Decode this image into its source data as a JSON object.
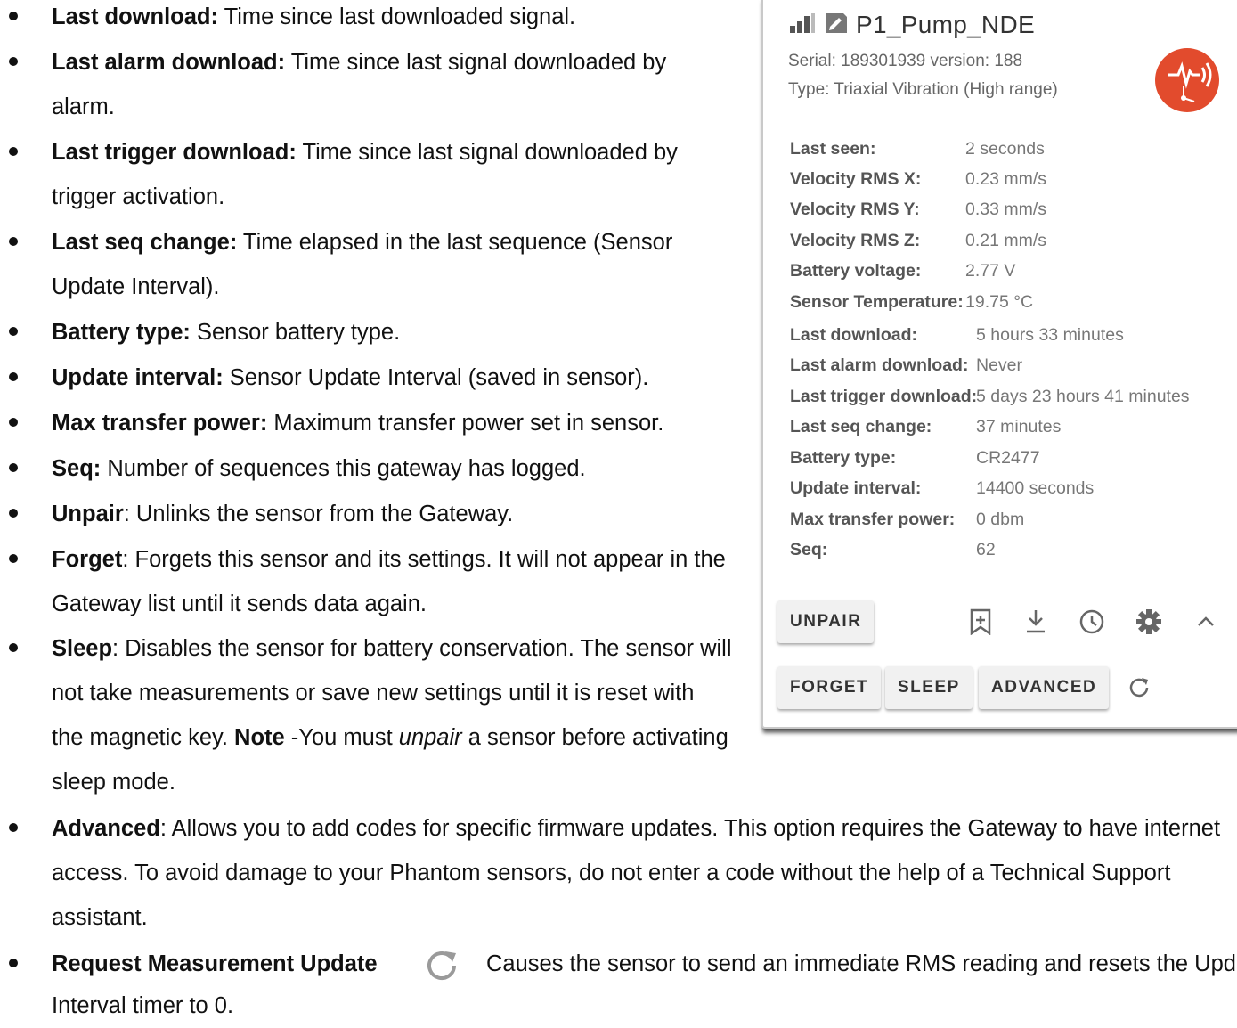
{
  "bullets": [
    {
      "term": "Last download:",
      "desc": " Time since last downloaded signal.",
      "lines": [
        "Last download: Time since last downloaded signal."
      ]
    },
    {
      "term": "Last alarm download:",
      "line1": " Time since last signal downloaded by",
      "line2": "alarm."
    },
    {
      "term": "Last trigger download:",
      "line1": " Time since last signal downloaded by",
      "line2": "trigger activation."
    },
    {
      "term": "Last seq change:",
      "line1": " Time elapsed in the last sequence (Sensor",
      "line2": "Update Interval)."
    },
    {
      "term": "Battery type:",
      "desc": " Sensor battery type."
    },
    {
      "term": "Update interval:",
      "desc": " Sensor Update Interval (saved in sensor)."
    },
    {
      "term": "Max transfer power:",
      "desc": " Maximum transfer power set in sensor."
    },
    {
      "term": "Seq:",
      "desc": " Number of sequences this gateway has logged."
    },
    {
      "term": "Unpair",
      "desc": ": Unlinks the sensor from the Gateway."
    },
    {
      "term": "Forget",
      "line1": ": Forgets this sensor and its settings. It will not appear in the",
      "line2": "Gateway list until it sends data again."
    },
    {
      "term": "Sleep",
      "line1": ": Disables the sensor for battery conservation. The sensor will",
      "line2": "not take measurements or save new settings until it is reset with",
      "line3a": "the magnetic key. ",
      "note": "Note",
      "line3b": " -You must ",
      "italic": "unpair",
      "line3c": " a sensor before activating",
      "line4": "sleep mode."
    },
    {
      "term": "Advanced",
      "line1": ": Allows you to add codes for specific firmware updates. This option requires the Gateway to have internet",
      "line2": "access. To avoid damage to your Phantom sensors, do not enter a code without the help of a Technical Support",
      "line3": "assistant."
    },
    {
      "term": "Request Measurement Update",
      "desc": "Causes the sensor to send an immediate RMS reading and resets the Update",
      "line2": "Interval timer to 0."
    }
  ],
  "card": {
    "title": "P1_Pump_NDE",
    "serial": "Serial: 189301939 version: 188",
    "type": "Type: Triaxial Vibration (High range)",
    "group1": [
      {
        "k": "Last seen:",
        "v": "2 seconds"
      },
      {
        "k": "Velocity RMS X:",
        "v": "0.23 mm/s"
      },
      {
        "k": "Velocity RMS Y:",
        "v": "0.33 mm/s"
      },
      {
        "k": "Velocity RMS Z:",
        "v": "0.21 mm/s"
      },
      {
        "k": "Battery voltage:",
        "v": "2.77 V"
      },
      {
        "k": "Sensor Temperature:",
        "v": "19.75 °C"
      }
    ],
    "group2": [
      {
        "k": "Last download:",
        "v": "5 hours 33 minutes"
      },
      {
        "k": "Last alarm download:",
        "v": "Never"
      },
      {
        "k": "Last trigger download:",
        "v": "5 days 23 hours 41 minutes"
      },
      {
        "k": "Last seq change:",
        "v": "37 minutes"
      },
      {
        "k": "Battery type:",
        "v": "CR2477"
      },
      {
        "k": "Update interval:",
        "v": "14400 seconds"
      },
      {
        "k": "Max transfer power:",
        "v": "0 dbm"
      },
      {
        "k": "Seq:",
        "v": "62"
      }
    ],
    "buttons": {
      "unpair": "UNPAIR",
      "forget": "FORGET",
      "sleep": "SLEEP",
      "advanced": "ADVANCED"
    },
    "icons": [
      "signal-icon",
      "tag-icon",
      "vibration-sensor-icon",
      "bookmark-add-icon",
      "download-icon",
      "clock-icon",
      "gear-icon",
      "chevron-up-icon",
      "refresh-icon"
    ],
    "accent": "#e24b2d"
  }
}
